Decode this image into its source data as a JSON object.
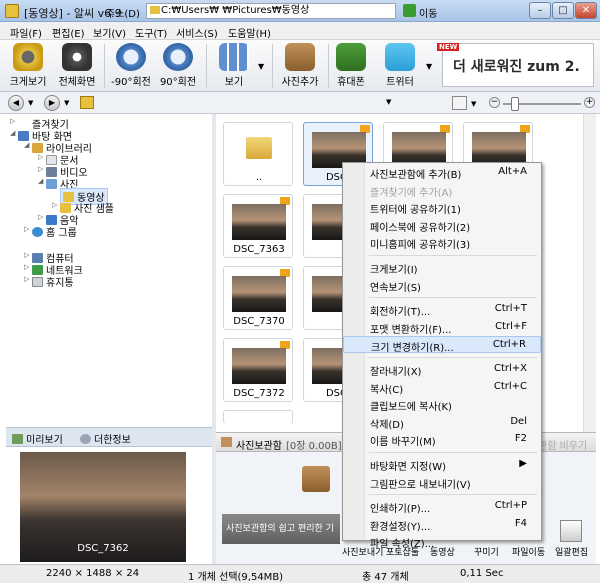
{
  "window": {
    "title": "[동영상] - 알씨 v6.9",
    "controls": [
      "–",
      "□",
      "✕"
    ]
  },
  "menu": [
    "파일(F)",
    "편집(E)",
    "보기(V)",
    "도구(T)",
    "서비스(S)",
    "도움말(H)"
  ],
  "toolbar": {
    "buttons": [
      "크게보기",
      "전체화면",
      "-90°회전",
      "90°회전",
      "보기",
      "사진추가",
      "휴대폰",
      "트위터"
    ],
    "new_badge": "NEW",
    "zum_text": "더 새로워진 zum 2."
  },
  "address": {
    "label": "주소(D)",
    "path": "C:₩Users₩              ₩Pictures₩동영상",
    "go": "이동"
  },
  "tree": [
    "즐겨찾기",
    "바탕 화면",
    "라이브러리",
    "문서",
    "비디오",
    "사진",
    "동영상",
    "사진 샘플",
    "음악",
    "홈 그룹",
    "컴퓨터",
    "네트워크",
    "휴지통"
  ],
  "thumbnails": [
    "..",
    "DSC_",
    "",
    "",
    "DSC_7363",
    "",
    "DSC_7370",
    "",
    "DSC_7372",
    "DSC_"
  ],
  "preview": {
    "tabs": [
      "미리보기",
      "더한정보"
    ],
    "caption": "DSC_7362"
  },
  "album": {
    "title": "사진보관함",
    "info": "[0장 0.00B]",
    "empty": "관함 비우기",
    "banner": "사진보관함의 쉽고 편리한 기",
    "actions": [
      "사진보내기",
      "포토샵툴",
      "동영상",
      "꾸미기",
      "파일이동",
      "일괄편집"
    ]
  },
  "context_menu": [
    {
      "label": "사진보관함에 추가(B)",
      "shortcut": "Alt+A"
    },
    {
      "label": "즐겨찾기에 추가(A)",
      "shortcut": "",
      "disabled": true
    },
    {
      "label": "트위터에 공유하기(1)",
      "shortcut": ""
    },
    {
      "label": "페이스북에 공유하기(2)",
      "shortcut": ""
    },
    {
      "label": "미니홈피에 공유하기(3)",
      "shortcut": ""
    },
    {
      "sep": true
    },
    {
      "label": "크게보기(I)",
      "shortcut": ""
    },
    {
      "label": "연속보기(S)",
      "shortcut": ""
    },
    {
      "sep": true
    },
    {
      "label": "회전하기(T)...",
      "shortcut": "Ctrl+T"
    },
    {
      "label": "포맷 변환하기(F)...",
      "shortcut": "Ctrl+F"
    },
    {
      "label": "크기 변경하기(R)...",
      "shortcut": "Ctrl+R",
      "highlight": true
    },
    {
      "sep": true
    },
    {
      "label": "잘라내기(X)",
      "shortcut": "Ctrl+X"
    },
    {
      "label": "복사(C)",
      "shortcut": "Ctrl+C"
    },
    {
      "label": "클립보드에 복사(K)",
      "shortcut": ""
    },
    {
      "label": "삭제(D)",
      "shortcut": "Del"
    },
    {
      "label": "이름 바꾸기(M)",
      "shortcut": "F2"
    },
    {
      "sep": true
    },
    {
      "label": "바탕화면 지정(W)",
      "shortcut": "▶"
    },
    {
      "label": "그림판으로 내보내기(V)",
      "shortcut": ""
    },
    {
      "sep": true
    },
    {
      "label": "인쇄하기(P)...",
      "shortcut": "Ctrl+P"
    },
    {
      "label": "환경설정(Y)...",
      "shortcut": "F4"
    },
    {
      "label": "파일 속성(Z)...",
      "shortcut": ""
    }
  ],
  "status": {
    "dims": "2240 × 1488 × 24",
    "selection": "1 개체 선택(9,54MB)",
    "total": "총 47 개체",
    "time": "0,11 Sec"
  },
  "colors": {
    "titlebar": "#b8cfec",
    "accent": "#3a9b2e",
    "highlight": "#d9e8fb",
    "jpg_badge": "#f3a21c"
  }
}
